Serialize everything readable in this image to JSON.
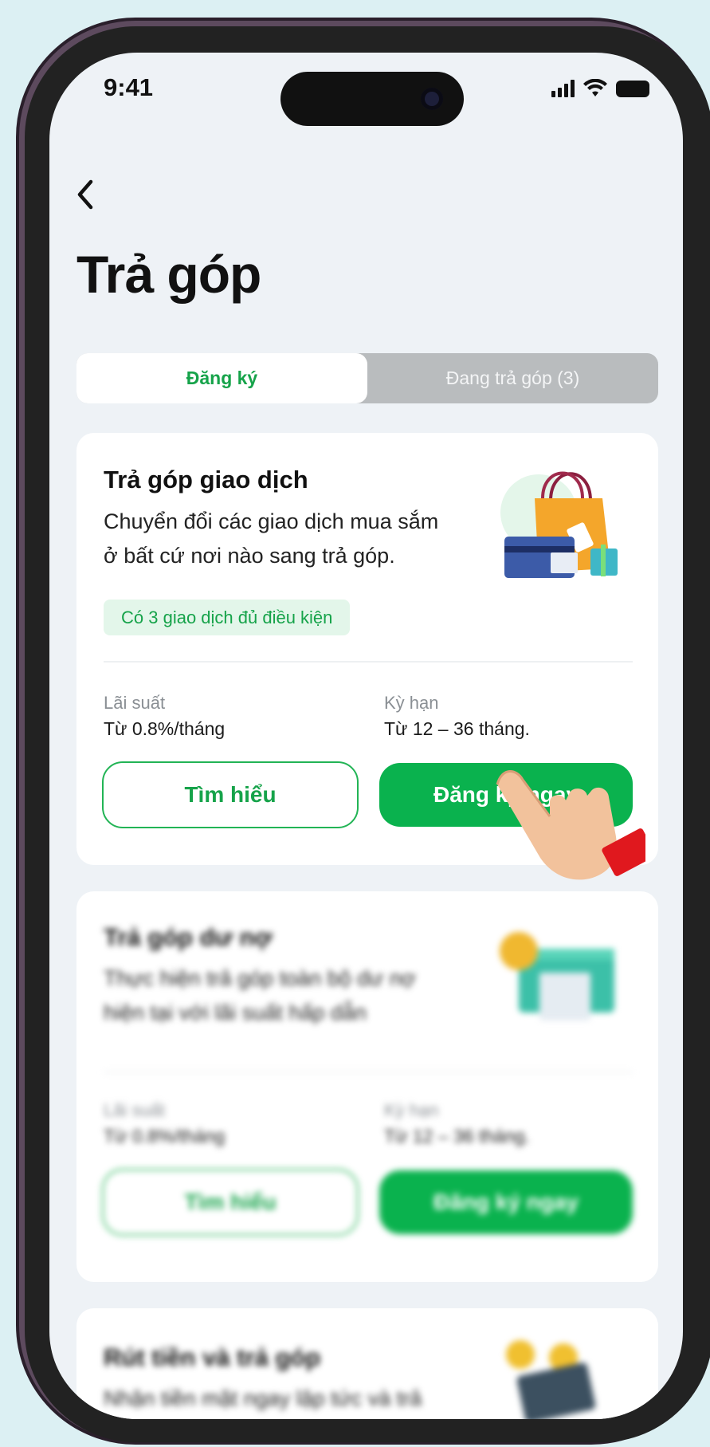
{
  "status_bar": {
    "time": "9:41"
  },
  "header": {
    "title": "Trả góp"
  },
  "tabs": [
    {
      "label": "Đăng ký",
      "active": true
    },
    {
      "label": "Đang trả góp (3)",
      "active": false
    }
  ],
  "cards": [
    {
      "title": "Trả góp giao dịch",
      "description": "Chuyển đổi các giao dịch mua sắm ở bất cứ nơi nào sang trả góp.",
      "eligible": "Có 3 giao dịch đủ điều kiện",
      "rate_label": "Lãi suất",
      "rate_value": "Từ 0.8%/tháng",
      "term_label": "Kỳ hạn",
      "term_value": "Từ 12 – 36 tháng.",
      "learn_button": "Tìm hiểu",
      "register_button": "Đăng ký ngay"
    },
    {
      "title": "Trả góp dư nợ",
      "description": "Thực hiện trả góp toàn bộ dư nợ hiện tại với lãi suất hấp dẫn",
      "rate_label": "Lãi suất",
      "rate_value": "Từ 0.8%/tháng",
      "term_label": "Kỳ hạn",
      "term_value": "Từ 12 – 36 tháng.",
      "learn_button": "Tìm hiểu",
      "register_button": "Đăng ký ngay"
    },
    {
      "title": "Rút tiền và trả góp",
      "description": "Nhận tiền mặt ngay lập tức và trả"
    }
  ],
  "colors": {
    "accent": "#0ab24e",
    "background": "#dcf0f3",
    "screen": "#eef2f6"
  },
  "icons": [
    "back-chevron-icon",
    "signal-icon",
    "wifi-icon",
    "battery-icon",
    "shopping-bag-illustration",
    "card-illustration",
    "pointing-hand-icon"
  ]
}
